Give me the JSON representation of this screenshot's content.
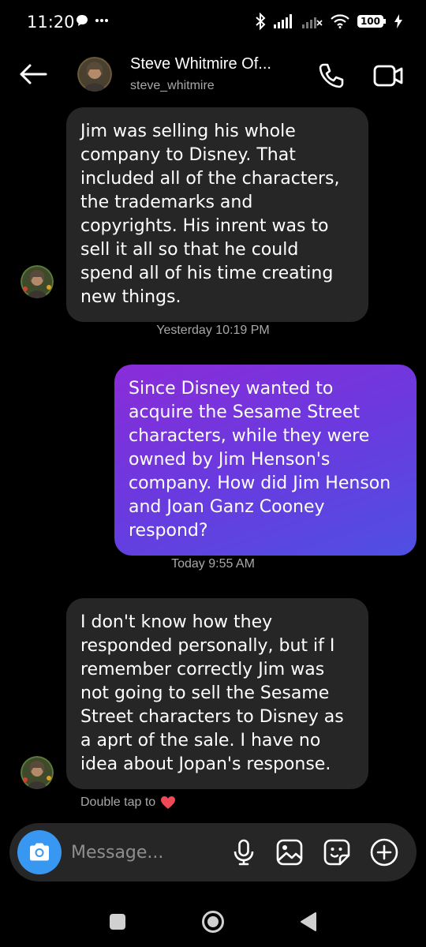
{
  "status_bar": {
    "time": "11:20",
    "battery": "100"
  },
  "header": {
    "name": "Steve Whitmire Of...",
    "username": "steve_whitmire"
  },
  "messages": [
    {
      "direction": "incoming",
      "text": "Jim was selling his whole company to Disney.  That included all of the characters, the trademarks and copyrights. His inrent was to sell it all so that he could spend all of his time creating new things."
    },
    {
      "direction": "outgoing",
      "text": "Since Disney wanted to acquire the Sesame Street characters, while they were owned by Jim Henson's company. How did Jim Henson and Joan Ganz Cooney respond?"
    },
    {
      "direction": "incoming",
      "text": "I don't know how they responded personally, but if I remember correctly Jim was not going to sell the Sesame Street characters to Disney as a aprt of the sale.  I have no idea about Jopan's response."
    }
  ],
  "timestamps": [
    "Yesterday 10:19 PM",
    "Today 9:55 AM"
  ],
  "hint": {
    "text": "Double tap to",
    "icon": "heart-icon"
  },
  "composer": {
    "placeholder": "Message..."
  },
  "colors": {
    "accent_blue": "#3897f0",
    "bubble_incoming": "#262626",
    "bubble_outgoing_start": "#8a2cd8",
    "bubble_outgoing_end": "#4f4fe3",
    "heart": "#ed4956"
  }
}
